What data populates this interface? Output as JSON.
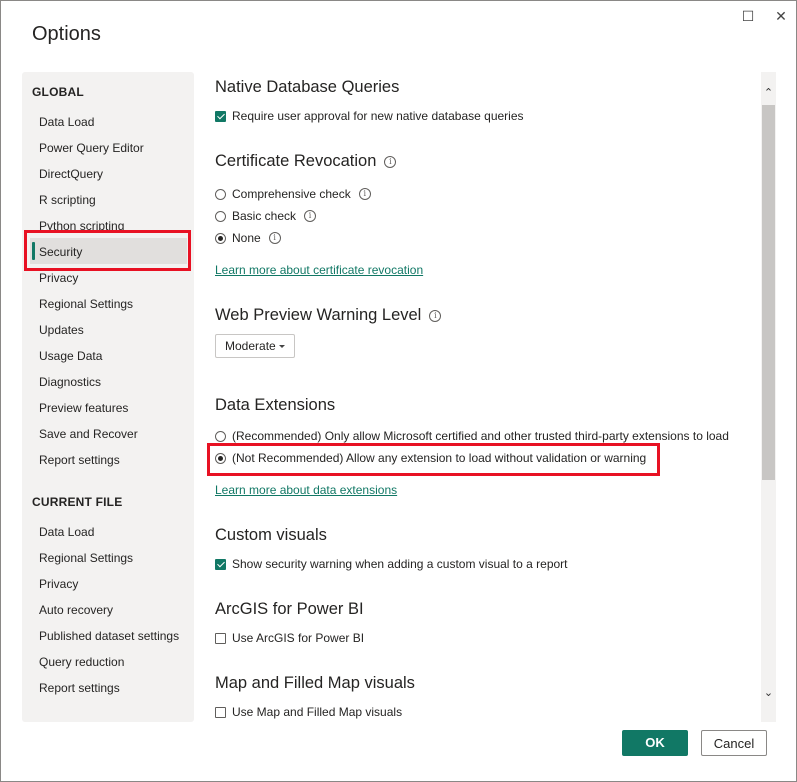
{
  "window": {
    "title": "Options",
    "maximize_glyph": "☐",
    "close_glyph": "✕"
  },
  "sidebar": {
    "global_heading": "GLOBAL",
    "global_items": [
      {
        "label": "Data Load"
      },
      {
        "label": "Power Query Editor"
      },
      {
        "label": "DirectQuery"
      },
      {
        "label": "R scripting"
      },
      {
        "label": "Python scripting"
      },
      {
        "label": "Security",
        "selected": true
      },
      {
        "label": "Privacy"
      },
      {
        "label": "Regional Settings"
      },
      {
        "label": "Updates"
      },
      {
        "label": "Usage Data"
      },
      {
        "label": "Diagnostics"
      },
      {
        "label": "Preview features"
      },
      {
        "label": "Save and Recover"
      },
      {
        "label": "Report settings"
      }
    ],
    "current_heading": "CURRENT FILE",
    "current_items": [
      {
        "label": "Data Load"
      },
      {
        "label": "Regional Settings"
      },
      {
        "label": "Privacy"
      },
      {
        "label": "Auto recovery"
      },
      {
        "label": "Published dataset settings"
      },
      {
        "label": "Query reduction"
      },
      {
        "label": "Report settings"
      }
    ]
  },
  "content": {
    "native_db": {
      "heading": "Native Database Queries",
      "checkbox_label": "Require user approval for new native database queries",
      "checked": true
    },
    "cert_revocation": {
      "heading": "Certificate Revocation",
      "options": [
        {
          "label": "Comprehensive check",
          "selected": false
        },
        {
          "label": "Basic check",
          "selected": false
        },
        {
          "label": "None",
          "selected": true
        }
      ],
      "link": "Learn more about certificate revocation"
    },
    "web_preview": {
      "heading": "Web Preview Warning Level",
      "selected_value": "Moderate"
    },
    "data_extensions": {
      "heading": "Data Extensions",
      "options": [
        {
          "label": "(Recommended) Only allow Microsoft certified and other trusted third-party extensions to load",
          "selected": false
        },
        {
          "label": "(Not Recommended) Allow any extension to load without validation or warning",
          "selected": true
        }
      ],
      "link": "Learn more about data extensions"
    },
    "custom_visuals": {
      "heading": "Custom visuals",
      "checkbox_label": "Show security warning when adding a custom visual to a report",
      "checked": true
    },
    "arcgis": {
      "heading": "ArcGIS for Power BI",
      "checkbox_label": "Use ArcGIS for Power BI",
      "checked": false
    },
    "map_visuals": {
      "heading": "Map and Filled Map visuals",
      "checkbox_label": "Use Map and Filled Map visuals",
      "checked": false
    },
    "info_glyph": "i"
  },
  "scrollbar": {
    "up_glyph": "⌃",
    "down_glyph": "⌄"
  },
  "footer": {
    "ok_label": "OK",
    "cancel_label": "Cancel"
  },
  "colors": {
    "accent": "#117865",
    "highlight": "#e81123"
  }
}
